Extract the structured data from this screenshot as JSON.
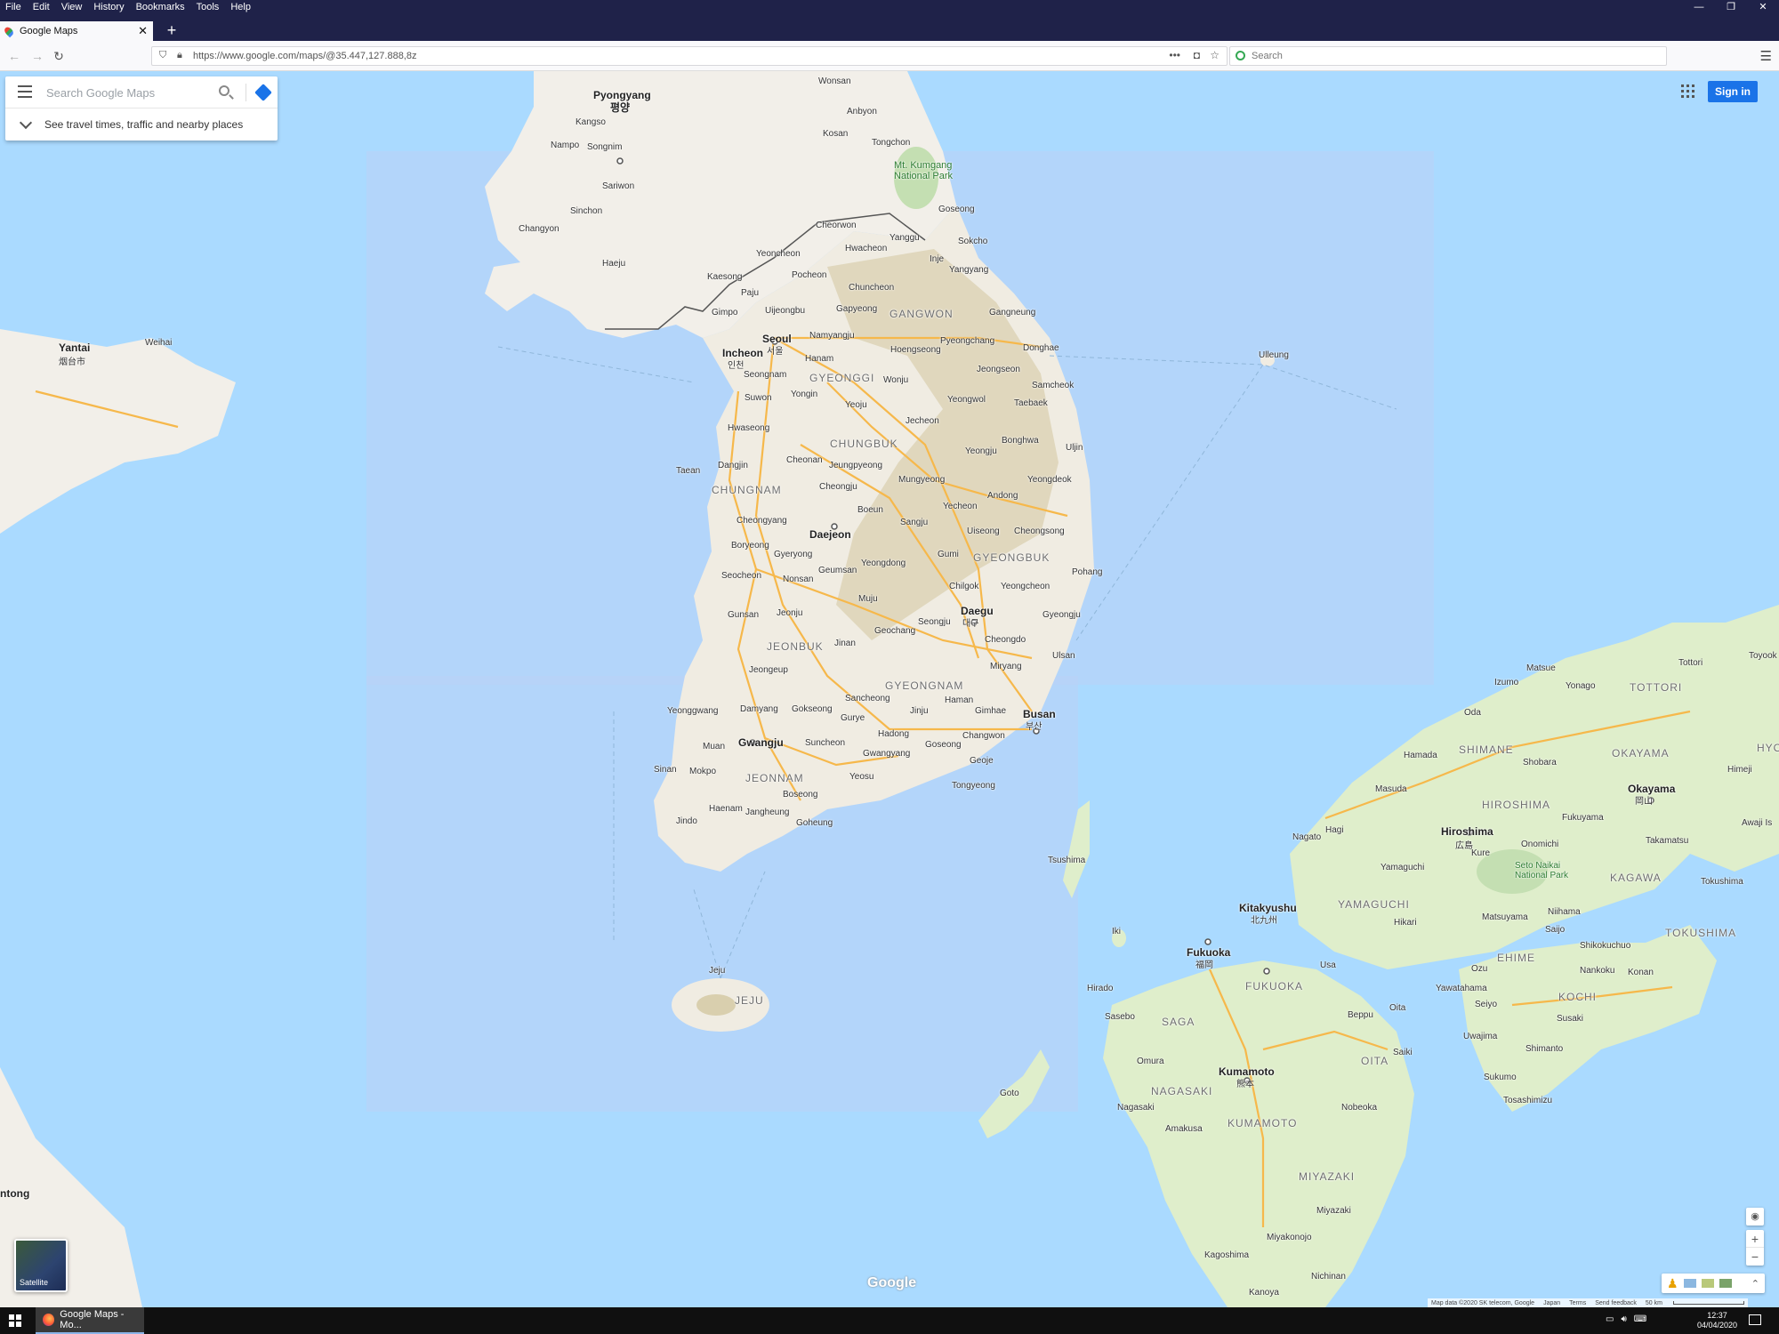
{
  "menubar": {
    "items": [
      "File",
      "Edit",
      "View",
      "History",
      "Bookmarks",
      "Tools",
      "Help"
    ],
    "controls": [
      "—",
      "❐",
      "✕"
    ]
  },
  "tab": {
    "title": "Google Maps",
    "close": "✕",
    "new_tab": "+"
  },
  "nav": {
    "back": "←",
    "forward": "→",
    "reload": "↻",
    "url": "https://www.google.com/maps/@35.447,127.888,8z",
    "page_actions": "•••",
    "search_placeholder": "Search",
    "menu": "☰"
  },
  "maps_search": {
    "placeholder": "Search Google Maps",
    "hint": "See travel times, traffic and nearby places"
  },
  "signin_label": "Sign in",
  "satellite_label": "Satellite",
  "logo_text": "Google",
  "zoom": {
    "in": "+",
    "out": "−",
    "locate": "◉",
    "collapse": "⌃"
  },
  "attribution": {
    "data": "Map data ©2020 SK telecom, Google",
    "country": "Japan",
    "terms": "Terms",
    "feedback": "Send feedback",
    "scale": "50 km"
  },
  "taskbar": {
    "task_title": "Google Maps - Mo...",
    "time": "12:37",
    "date": "04/04/2020",
    "tray_icons": [
      "network-icon",
      "volume-icon",
      "keyboard-icon"
    ]
  },
  "colors": {
    "land": "#f2efe9",
    "water": "#aadaff",
    "park": "#c4dfb2",
    "road": "#f6b84b",
    "accent": "#1a73e8",
    "chrome_dark": "#1f2249"
  },
  "map_labels": {
    "pyongyang": "Pyongyang",
    "pyongyang_ko": "평양",
    "kangso": "Kangso",
    "nampo": "Nampo",
    "songnim": "Songnim",
    "sariwon": "Sariwon",
    "sinchon": "Sinchon",
    "changyon": "Changyon",
    "haeju": "Haeju",
    "kaesong": "Kaesong",
    "wonsan": "Wonsan",
    "anbyon": "Anbyon",
    "kosan": "Kosan",
    "tongchon": "Tongchon",
    "mt_kumgang": "Mt. Kumgang National Park",
    "cheorwon": "Cheorwon",
    "goseong": "Goseong",
    "hwacheon": "Hwacheon",
    "yanggu": "Yanggu",
    "sokcho": "Sokcho",
    "yeoncheon": "Yeoncheon",
    "pocheon": "Pocheon",
    "inje": "Inje",
    "yangyang": "Yangyang",
    "paju": "Paju",
    "chuncheon": "Chuncheon",
    "gapyeong": "Gapyeong",
    "gangwon": "GANGWON",
    "gangneung": "Gangneung",
    "gimpo": "Gimpo",
    "uijeongbu": "Uijeongbu",
    "seoul": "Seoul",
    "seoul_ko": "서울",
    "namyangju": "Namyangju",
    "hoengseong": "Hoengseong",
    "pyeongchang": "Pyeongchang",
    "donghae": "Donghae",
    "incheon": "Incheon",
    "seongnam": "Seongnam",
    "hanam": "Hanam",
    "gyeonggi": "GYEONGGI",
    "wonju": "Wonju",
    "jeongseon": "Jeongseon",
    "samcheok": "Samcheok",
    "suwon": "Suwon",
    "yongin": "Yongin",
    "yeoju": "Yeoju",
    "yeongwol": "Yeongwol",
    "taebaek": "Taebaek",
    "hwaseong": "Hwaseong",
    "jecheon": "Jecheon",
    "chungbuk": "CHUNGBUK",
    "bonghwa": "Bonghwa",
    "uljin": "Uljin",
    "cheonan": "Cheonan",
    "dangjin": "Dangjin",
    "taean": "Taean",
    "jeungpyeong": "Jeungpyeong",
    "yeongju": "Yeongju",
    "cheongju": "Cheongju",
    "chungnam": "CHUNGNAM",
    "mungyeong": "Mungyeong",
    "andong": "Andong",
    "yeongdeok": "Yeongdeok",
    "yecheon": "Yecheon",
    "cheongyang": "Cheongyang",
    "boeun": "Boeun",
    "sangju": "Sangju",
    "daejeon": "Daejeon",
    "uiseong": "Uiseong",
    "cheongsong": "Cheongsong",
    "boryeong": "Boryeong",
    "gyeryong": "Gyeryong",
    "gumi": "Gumi",
    "gyeongbuk": "GYEONGBUK",
    "seocheon": "Seocheon",
    "geumsan": "Geumsan",
    "yeongdong": "Yeongdong",
    "nonsan": "Nonsan",
    "pohang": "Pohang",
    "yeongcheon": "Yeongcheon",
    "chilgok": "Chilgok",
    "gunsan": "Gunsan",
    "muju": "Muju",
    "jeonju": "Jeonju",
    "daegu": "Daegu",
    "gyeongju": "Gyeongju",
    "jeonbuk": "JEONBUK",
    "geochang": "Geochang",
    "seongju": "Seongju",
    "jinan": "Jinan",
    "cheongdo": "Cheongdo",
    "ulsan": "Ulsan",
    "jeongeup": "Jeongeup",
    "miryang": "Miryang",
    "gyeongnam": "GYEONGNAM",
    "yeonggwang": "Yeonggwang",
    "damyang": "Damyang",
    "sancheong": "Sancheong",
    "haman": "Haman",
    "gokseong": "Gokseong",
    "gurye": "Gurye",
    "jinju": "Jinju",
    "gimhae": "Gimhae",
    "busan": "Busan",
    "gwangju": "Gwangju",
    "suncheon": "Suncheon",
    "hadong": "Hadong",
    "muan": "Muan",
    "changwon": "Changwon",
    "goseong_s": "Goseong",
    "geoje": "Geoje",
    "gwangyang": "Gwangyang",
    "mokpo": "Mokpo",
    "jeonnam": "JEONNAM",
    "yeosu": "Yeosu",
    "sinan": "Sinan",
    "tongyeong": "Tongyeong",
    "haenam": "Haenam",
    "boseong": "Boseong",
    "jangheung": "Jangheung",
    "goheung": "Goheung",
    "jindo": "Jindo",
    "jeju_city": "Jeju",
    "jeju": "JEJU",
    "ulleung": "Ulleung",
    "tsushima": "Tsushima",
    "iki": "Iki",
    "goto": "Goto",
    "hirado": "Hirado",
    "yantai": "Yantai",
    "weihai": "Weihai",
    "rongcheng": "ntong",
    "matsue": "Matsue",
    "tottori_city": "Tottori",
    "tottori": "TOTTORI",
    "izumo": "Izumo",
    "yonago": "Yonago",
    "oda": "Oda",
    "shimane": "SHIMANE",
    "hamada": "Hamada",
    "shobara": "Shobara",
    "okayama": "OKAYAMA",
    "okayama_city": "Okayama",
    "masuda": "Masuda",
    "hiroshima": "HIROSHIMA",
    "hiroshima_city": "Hiroshima",
    "fukuyama": "Fukuyama",
    "nagato": "Nagato",
    "hagi": "Hagi",
    "onomichi": "Onomichi",
    "kure": "Kure",
    "takamatsu": "Takamatsu",
    "yamaguchi_city": "Yamaguchi",
    "seto_naikai": "Seto Naikai National Park",
    "kagawa": "KAGAWA",
    "tokushima_city": "Tokushima",
    "yamaguchi": "YAMAGUCHI",
    "kitakyushu": "Kitakyushu",
    "hikari": "Hikari",
    "matsuyama": "Matsuyama",
    "niihama": "Niihama",
    "tokushima": "TOKUSHIMA",
    "fukuoka_city": "Fukuoka",
    "fukuoka": "FUKUOKA",
    "usa": "Usa",
    "saijo": "Saijo",
    "shikokuchuo": "Shikokuchuo",
    "ozu": "Ozu",
    "ehime": "EHIME",
    "nankoku": "Nankoku",
    "konan": "Konan",
    "beppu": "Beppu",
    "oita_city": "Oita",
    "yawatahama": "Yawatahama",
    "kochi": "KOCHI",
    "saga": "SAGA",
    "sasebo": "Sasebo",
    "seiyo": "Seiyo",
    "susaki": "Susaki",
    "oita": "OITA",
    "saiki": "Saiki",
    "uwajima": "Uwajima",
    "shimanto": "Shimanto",
    "omura": "Omura",
    "kumamoto_city": "Kumamoto",
    "nagasaki": "NAGASAKI",
    "sukumo": "Sukumo",
    "tosashimizu": "Tosashimizu",
    "nagasaki_city": "Nagasaki",
    "nobeoka": "Nobeoka",
    "kumamoto": "KUMAMOTO",
    "amakusa": "Amakusa",
    "miyazaki": "MIYAZAKI",
    "miyazaki_city": "Miyazaki",
    "miyakonojo": "Miyakonojo",
    "kagoshima": "Kagoshima",
    "nichinan": "Nichinan",
    "kanoya": "Kanoya",
    "toyooka": "Toyook",
    "hyo": "HYO",
    "himeji": "Himeji",
    "awaji": "Awaji Is",
    "kitakyushu_ja": "北九州",
    "hiroshima_ja": "広島",
    "okayama_ja": "岡山",
    "fukuoka_ja": "福岡",
    "kumamoto_ja": "熊本",
    "daegu_ko": "대구",
    "busan_ko": "부산",
    "incheon_ko": "인천",
    "yantai_zh": "烟台市"
  }
}
